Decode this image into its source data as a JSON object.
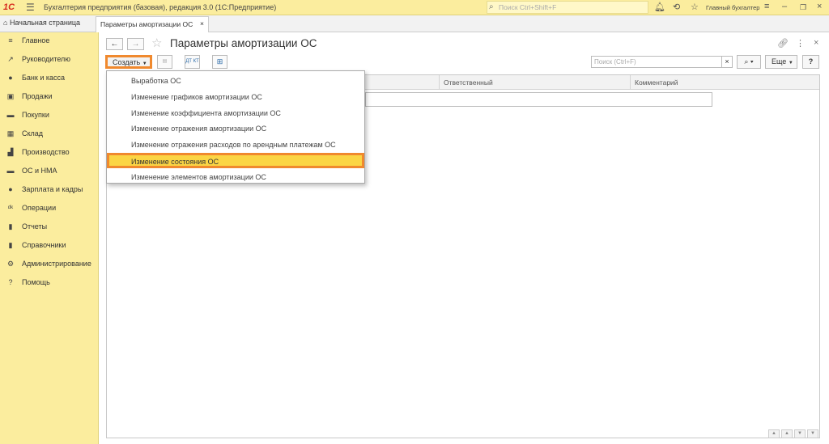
{
  "titlebar": {
    "logo": "1С",
    "app_title": "Бухгалтерия предприятия (базовая), редакция 3.0  (1С:Предприятие)",
    "search_placeholder": "Поиск Ctrl+Shift+F",
    "user": "Главный бухгалтер"
  },
  "tabs": {
    "home": "Начальная страница",
    "active": "Параметры амортизации ОС"
  },
  "sidebar": {
    "items": [
      {
        "label": "Главное",
        "icon": "menu-icon"
      },
      {
        "label": "Руководителю",
        "icon": "trend-icon"
      },
      {
        "label": "Банк и касса",
        "icon": "coin-icon"
      },
      {
        "label": "Продажи",
        "icon": "bag-icon"
      },
      {
        "label": "Покупки",
        "icon": "cart-icon"
      },
      {
        "label": "Склад",
        "icon": "warehouse-icon"
      },
      {
        "label": "Производство",
        "icon": "factory-icon"
      },
      {
        "label": "ОС и НМА",
        "icon": "truck-icon"
      },
      {
        "label": "Зарплата и кадры",
        "icon": "person-icon"
      },
      {
        "label": "Операции",
        "icon": "dt-kt-icon"
      },
      {
        "label": "Отчеты",
        "icon": "bar-chart-icon"
      },
      {
        "label": "Справочники",
        "icon": "book-icon"
      },
      {
        "label": "Администрирование",
        "icon": "gear-icon"
      },
      {
        "label": "Помощь",
        "icon": "question-icon"
      }
    ]
  },
  "form": {
    "title": "Параметры амортизации ОС",
    "create_label": "Создать",
    "search_placeholder": "Поиск (Ctrl+F)",
    "more_label": "Еще",
    "help_label": "?",
    "dt_kt": "ДТ КТ"
  },
  "table": {
    "columns": [
      "Ответственный",
      "Комментарий"
    ]
  },
  "create_menu": {
    "items": [
      "Выработка ОС",
      "Изменение графиков амортизации ОС",
      "Изменение коэффициента амортизации ОС",
      "Изменение отражения амортизации ОС",
      "Изменение отражения расходов по арендным платежам ОС",
      "Изменение состояния ОС",
      "Изменение элементов амортизации ОС"
    ],
    "highlighted_index": 5
  },
  "colors": {
    "panel_yellow": "#fbed9e",
    "highlight_yellow": "#fbd544",
    "highlight_orange": "#f0892e"
  }
}
